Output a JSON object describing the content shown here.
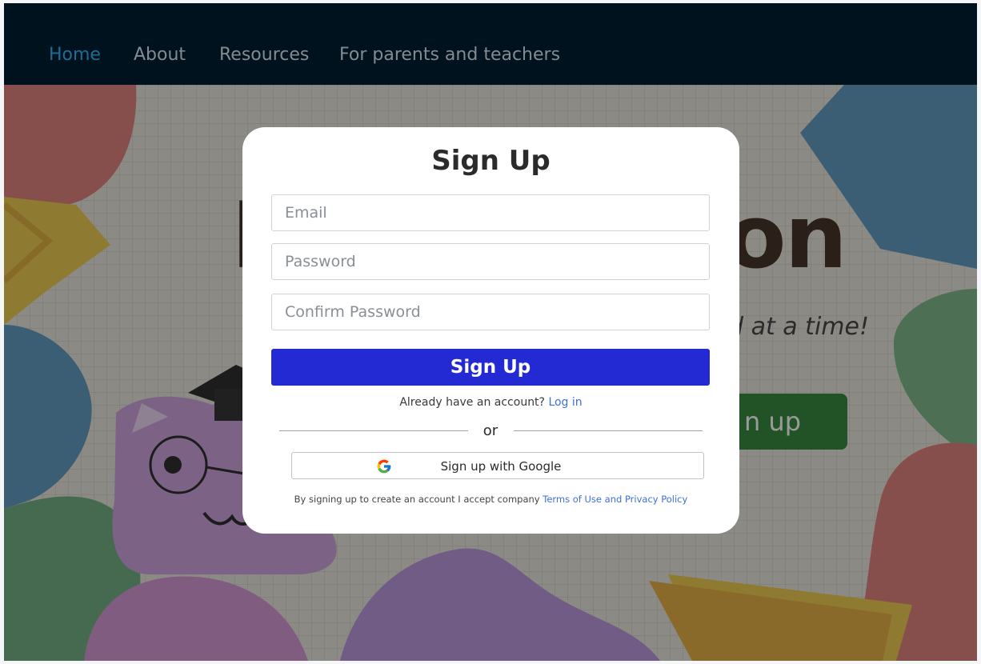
{
  "nav": {
    "items": [
      {
        "label": "Home"
      },
      {
        "label": "About"
      },
      {
        "label": "Resources"
      },
      {
        "label": "For parents and teachers"
      }
    ],
    "active_color": "#1e6e94"
  },
  "hero": {
    "title_lead": "l",
    "title_tail": "on",
    "subtitle_visible": "d at a time!",
    "signup_visible": "n up"
  },
  "modal": {
    "title": "Sign Up",
    "email_placeholder": "Email",
    "password_placeholder": "Password",
    "confirm_placeholder": "Confirm Password",
    "submit_label": "Sign Up",
    "login_prompt": "Already have an account?",
    "login_link": "Log in",
    "divider_text": "or",
    "google_label": "Sign up with Google",
    "google_icon": "google-g-icon",
    "legal_text": "By signing up to create an account I accept company",
    "legal_link": "Terms of Use and Privacy Policy"
  },
  "colors": {
    "navbar": "#00121e",
    "primary_button": "#2329d3",
    "link": "#3f6fd8",
    "hero_signup": "#1b7a24"
  }
}
